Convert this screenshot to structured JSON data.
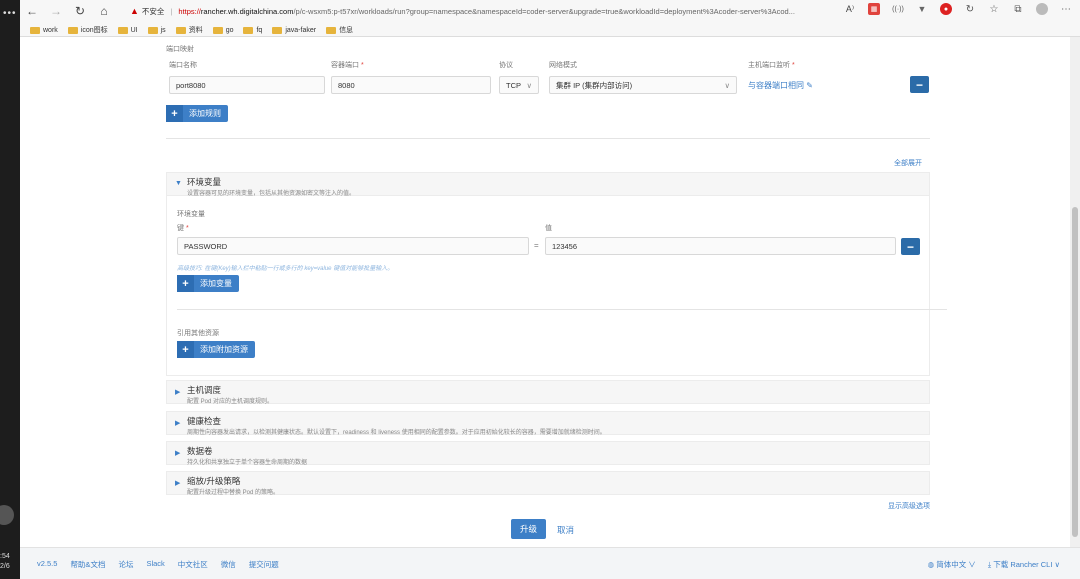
{
  "browser": {
    "insecure_label": "不安全",
    "url_proto": "https://",
    "url_host": "rancher.wh.digitalchina.com",
    "url_path": "/p/c-wsxm5:p-t57xr/workloads/run?group=namespace&namespaceId=coder-server&upgrade=true&workloadId=deployment%3Acoder-server%3Acod...",
    "bookmarks": [
      "work",
      "icon图标",
      "UI",
      "js",
      "资料",
      "go",
      "fq",
      "java-faker",
      "信息"
    ]
  },
  "taskbar": {
    "time": ":54",
    "date": "2/6"
  },
  "ports": {
    "section_label": "端口映射",
    "col_name": "端口名称",
    "col_container_port": "容器端口",
    "col_protocol": "协议",
    "col_network_mode": "网络模式",
    "col_host_port": "主机端口监听",
    "required_mark": "*",
    "name_value": "port8080",
    "container_port_value": "8080",
    "protocol_value": "TCP",
    "network_mode_value": "集群 IP (集群内部访问)",
    "host_port_link": "与容器端口相同",
    "add_rule_label": "添加规则"
  },
  "expand_all": "全部展开",
  "env": {
    "title": "环境变量",
    "desc": "设置容器可见的环境变量，包括从其他资源如密文等注入的值。",
    "sub_label": "环境变量",
    "key_label": "键",
    "value_label": "值",
    "key_value": "PASSWORD",
    "equals": "=",
    "value_value": "123456",
    "hint": "高级技巧: 在键(Key)输入栏中粘贴一行或多行的 key=value 键值对能够批量输入。",
    "add_var_label": "添加变量",
    "ref_label": "引用其他资源",
    "add_ref_label": "添加附加资源"
  },
  "sections": [
    {
      "title": "主机调度",
      "desc": "配置 Pod 对应的主机调度规则。"
    },
    {
      "title": "健康检查",
      "desc": "周期性向容器发出请求，以检测其健康状态。默认设置下，readiness 和 liveness 使用相同的配置参数。对于应用初始化较长的容器，需要增加就绪检测时间。"
    },
    {
      "title": "数据卷",
      "desc": "持久化和共享独立于单个容器生命周期的数据"
    },
    {
      "title": "缩放/升级策略",
      "desc": "配置升级过程中替换 Pod 的策略。"
    }
  ],
  "show_advanced": "显示高级选项",
  "upgrade_label": "升级",
  "cancel_label": "取消",
  "footer": {
    "version": "v2.5.5",
    "links": [
      "帮助&文档",
      "论坛",
      "Slack",
      "中文社区",
      "微信",
      "提交问题"
    ],
    "language": "简体中文",
    "download": "下载 Rancher CLI"
  },
  "colors": {
    "accent": "#3d7fc7",
    "required": "#e0433d"
  }
}
